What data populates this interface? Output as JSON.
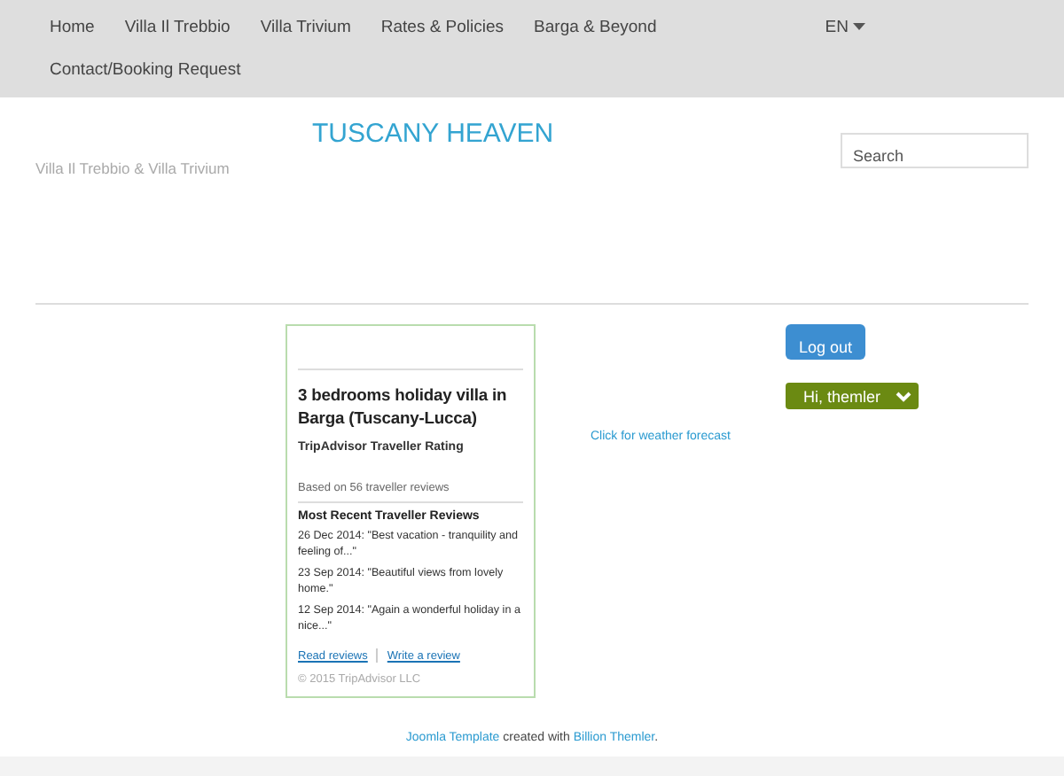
{
  "nav": {
    "items": [
      "Home",
      "Villa Il Trebbio",
      "Villa Trivium",
      "Rates & Policies",
      "Barga & Beyond",
      "Contact/Booking Request"
    ],
    "language": "EN"
  },
  "header": {
    "title": "TUSCANY HEAVEN",
    "subtitle": "Villa Il Trebbio & Villa Trivium",
    "search": {
      "placeholder": "Search"
    }
  },
  "widget": {
    "heading": "3 bedrooms holiday villa in Barga (Tuscany-Lucca)",
    "rating_label": "TripAdvisor Traveller Rating",
    "based_on": "Based on 56 traveller reviews",
    "reviews_heading": "Most Recent Traveller Reviews",
    "reviews": [
      "26 Dec 2014: \"Best vacation - tranquility and feeling of...\"",
      "23 Sep 2014: \"Beautiful views from lovely home.\"",
      "12 Sep 2014: \"Again a wonderful holiday in a nice...\""
    ],
    "links": [
      "Read reviews",
      "Write a review"
    ],
    "copyright": "© 2015 TripAdvisor LLC"
  },
  "weather_link": "Click for weather forecast",
  "logout_button": "Log out",
  "user_menu": "Hi, themler",
  "footer": {
    "link_1": "Joomla Template",
    "middle": "created with",
    "link_2": "Billion Themler",
    "end": "."
  }
}
